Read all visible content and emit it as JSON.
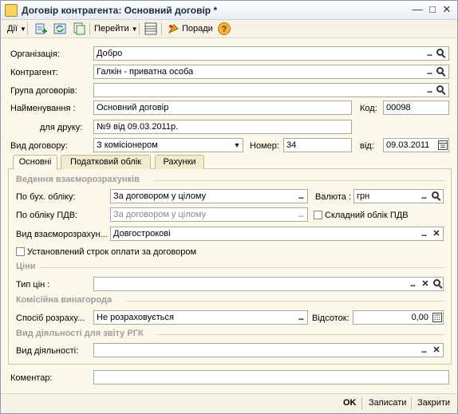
{
  "window": {
    "title": "Договір контрагента: Основний договір *"
  },
  "toolbar": {
    "actions_label": "Дії",
    "goto_label": "Перейти",
    "hints_label": "Поради",
    "help_icon": "?"
  },
  "form": {
    "org_label": "Організація:",
    "org_value": "Добро",
    "contractor_label": "Контрагент:",
    "contractor_value": "Галкін - приватна особа",
    "group_label": "Група договорів:",
    "group_value": "",
    "name_label": "Найменування :",
    "name_value": "Основний договір",
    "code_label": "Код:",
    "code_value": "00098",
    "print_label": "для друку:",
    "print_value": "№9 від 09.03.2011р.",
    "type_label": "Вид договору:",
    "type_value": "З комісіонером",
    "number_label": "Номер:",
    "number_value": "34",
    "date_label": "від:",
    "date_value": "09.03.2011"
  },
  "tabs": [
    {
      "label": "Основні"
    },
    {
      "label": "Податковий облік"
    },
    {
      "label": "Рахунки"
    }
  ],
  "settlements": {
    "section_label": "Ведення взаєморозрахунків",
    "acc_label": "По бух. обліку:",
    "acc_value": "За договором у цілому",
    "currency_label": "Валюта :",
    "currency_value": "грн",
    "vat_label": "По обліку ПДВ:",
    "vat_value": "За договором у цілому",
    "complex_vat_label": "Складний облік ПДВ",
    "kind_label": "Вид взаєморозрахун...",
    "kind_value": "Довгострокові",
    "due_label": "Установлений строк оплати за договором"
  },
  "prices": {
    "section_label": "Ціни",
    "type_label": "Тип цін :",
    "type_value": ""
  },
  "commission": {
    "section_label": "Комісійна винагорода",
    "method_label": "Спосіб розраху...",
    "method_value": "Не розраховується",
    "percent_label": "Відсоток:",
    "percent_value": "0,00"
  },
  "activity": {
    "section_label": "Вид діяльності для звіту РГК",
    "kind_label": "Вид діяльності:",
    "kind_value": ""
  },
  "comment": {
    "label": "Коментар:",
    "value": ""
  },
  "footer": {
    "ok_label": "OK",
    "save_label": "Записати",
    "close_label": "Закрити"
  }
}
